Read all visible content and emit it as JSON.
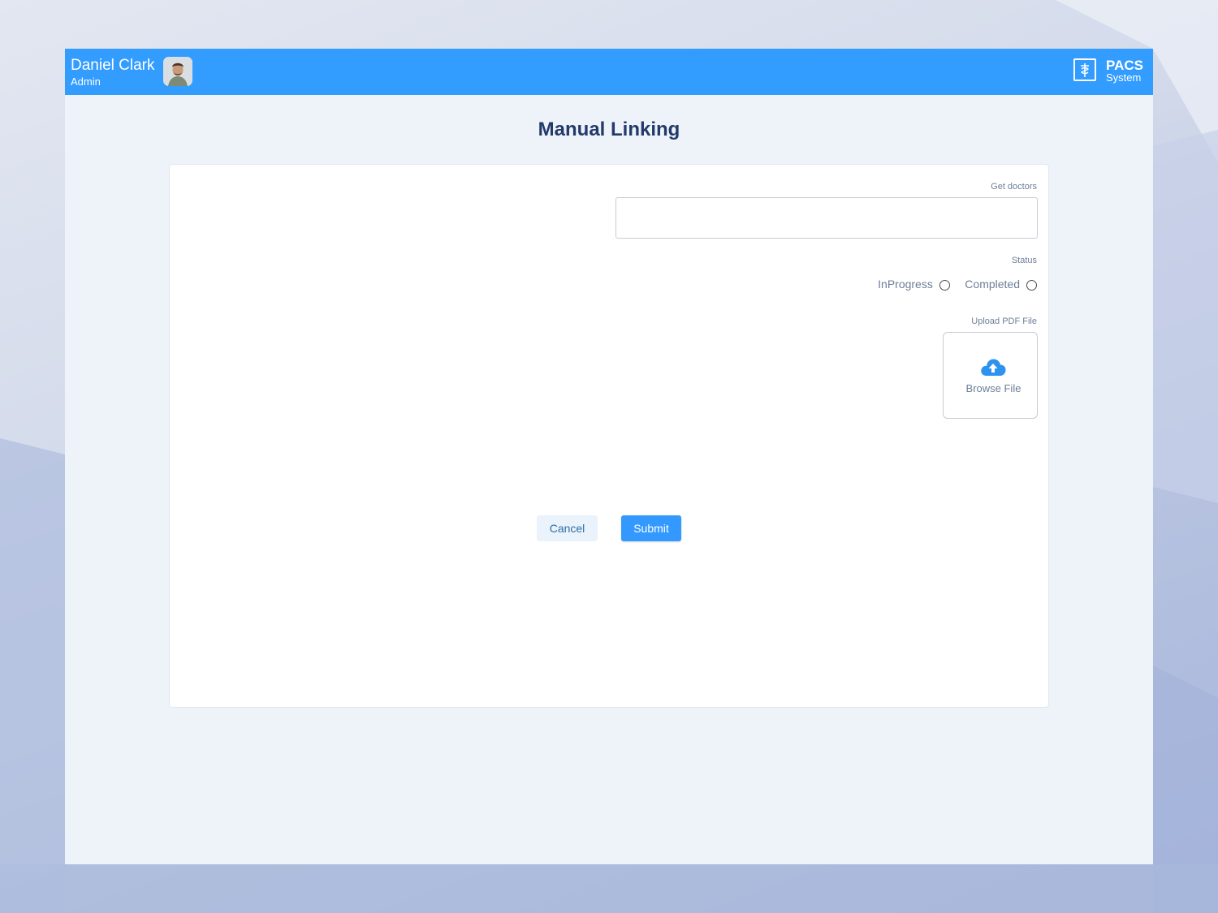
{
  "header": {
    "user_name": "Daniel Clark",
    "user_role": "Admin",
    "brand_title": "PACS",
    "brand_subtitle": "System",
    "bar_color": "#339cff"
  },
  "page": {
    "title": "Manual Linking"
  },
  "form": {
    "doctors_label": "Get doctors",
    "doctors_value": "",
    "status_label": "Status",
    "status_options": [
      {
        "label": "InProgress",
        "selected": false
      },
      {
        "label": "Completed",
        "selected": false
      }
    ],
    "upload_label": "Upload PDF File",
    "upload_button": "Browse File"
  },
  "actions": {
    "cancel": "Cancel",
    "submit": "Submit",
    "accent": "#3399ff"
  }
}
